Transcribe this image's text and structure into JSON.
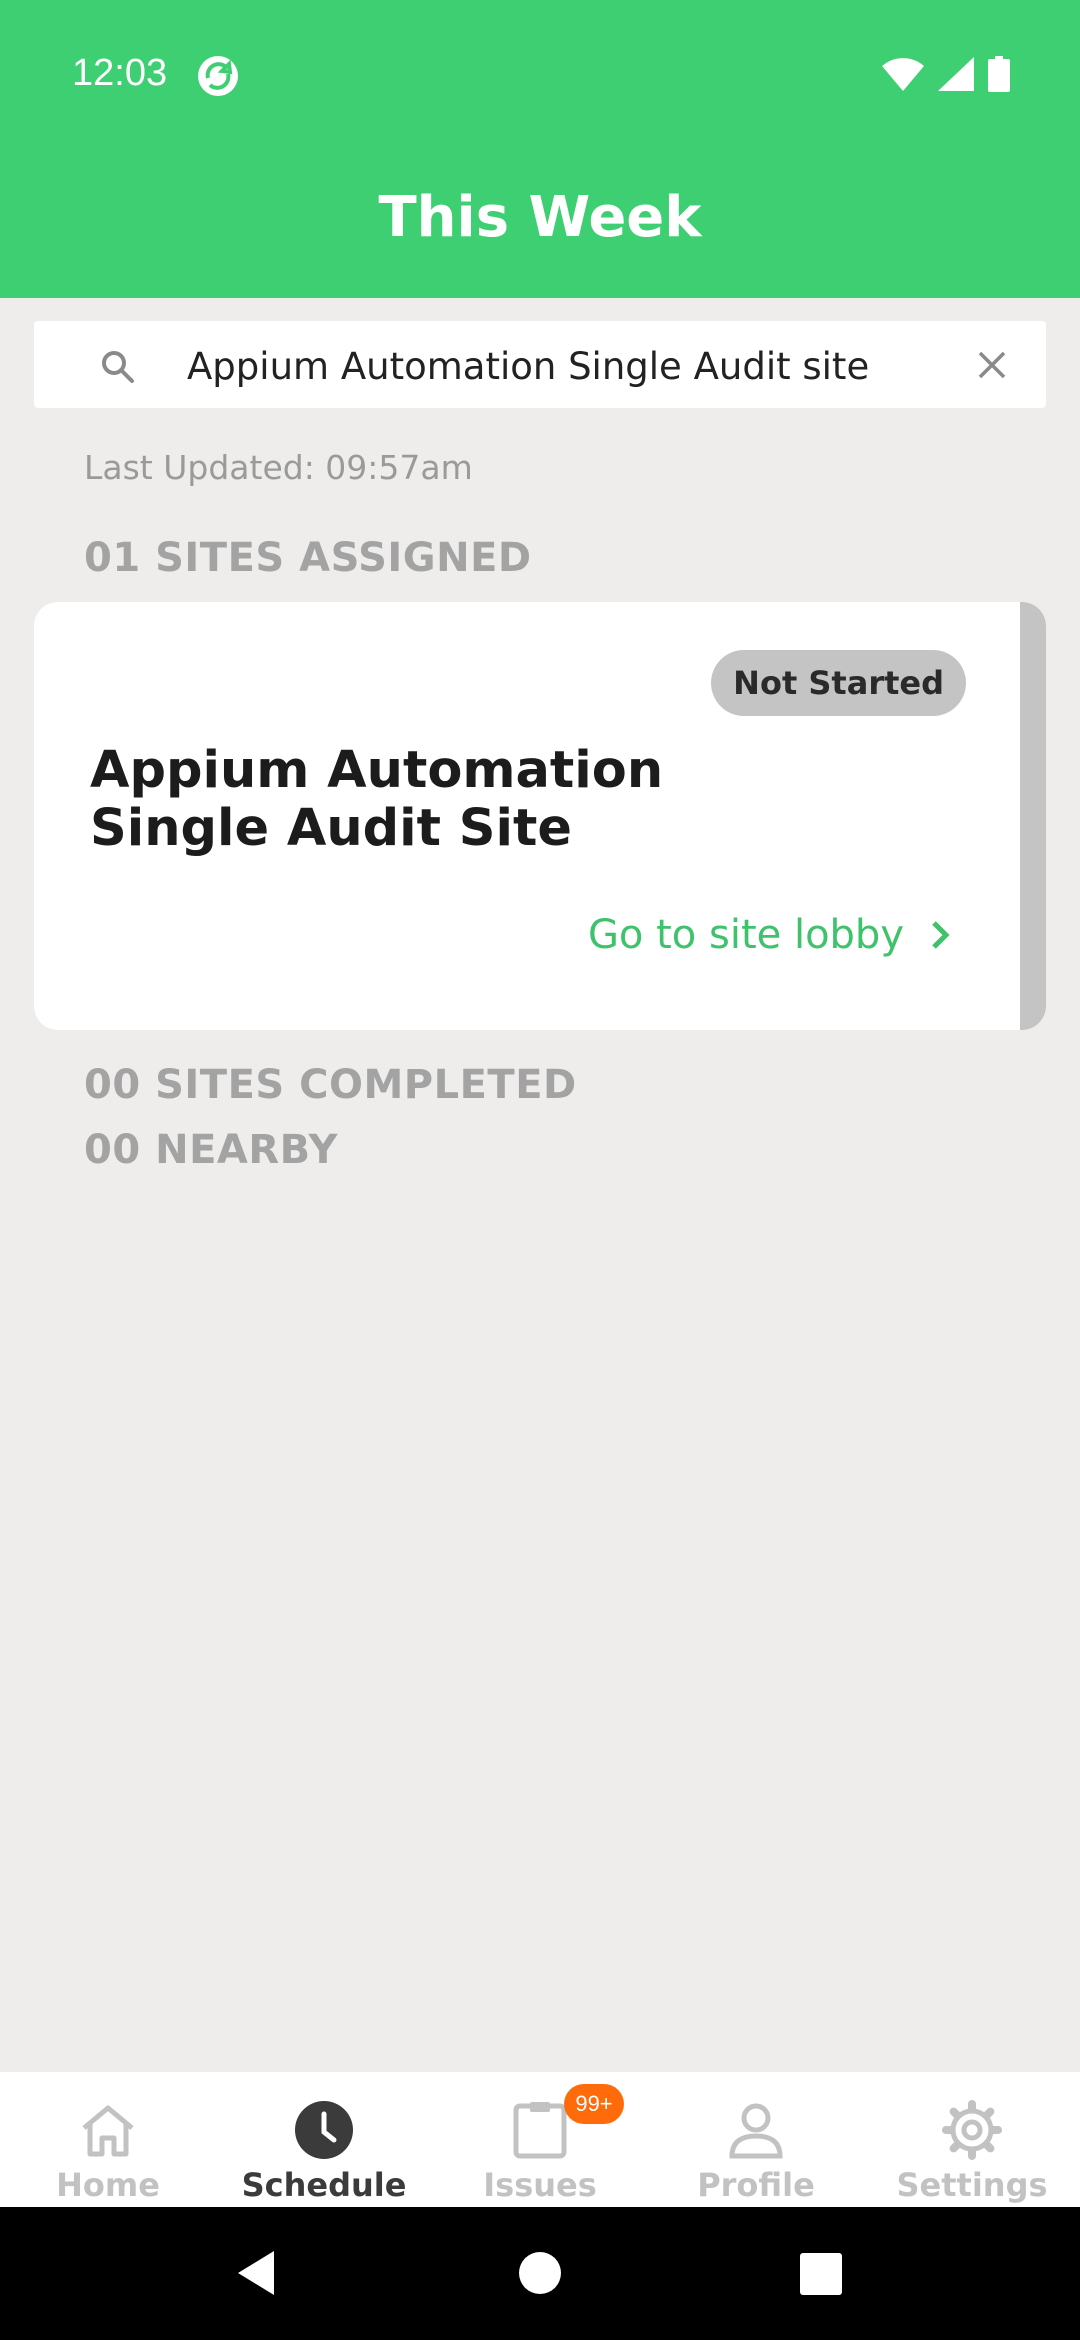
{
  "status_bar": {
    "time": "12:03"
  },
  "header": {
    "title": "This Week"
  },
  "search": {
    "value": "Appium Automation Single Audit site"
  },
  "last_updated": "Last Updated: 09:57am",
  "sections": {
    "assigned": "01 SITES ASSIGNED",
    "completed": "00 SITES COMPLETED",
    "nearby": "00 NEARBY"
  },
  "site_card": {
    "status": "Not Started",
    "name": "Appium Automation Single Audit Site",
    "link_label": "Go to site lobby"
  },
  "bottom_nav": {
    "items": [
      {
        "label": "Home",
        "icon": "home-icon"
      },
      {
        "label": "Schedule",
        "icon": "clock-icon",
        "active": true
      },
      {
        "label": "Issues",
        "icon": "clipboard-icon",
        "badge": "99+"
      },
      {
        "label": "Profile",
        "icon": "person-icon"
      },
      {
        "label": "Settings",
        "icon": "gear-icon"
      }
    ]
  },
  "colors": {
    "brand_green": "#3ecf72",
    "link_green": "#3ec26a",
    "badge_orange": "#ff6a0a",
    "background": "#eeedeb"
  }
}
